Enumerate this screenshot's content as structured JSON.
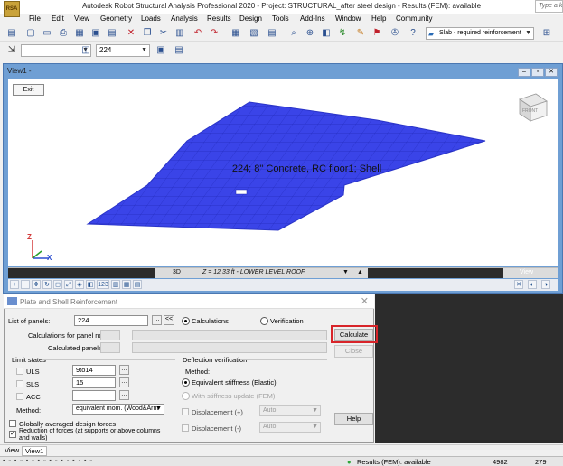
{
  "window": {
    "title": "Autodesk Robot Structural Analysis Professional 2020 - Project: STRUCTURAL_after steel design - Results (FEM): available",
    "app_icon_text": "RSA",
    "search_placeholder": "Type a keyword"
  },
  "menu": [
    "File",
    "Edit",
    "View",
    "Geometry",
    "Loads",
    "Analysis",
    "Results",
    "Design",
    "Tools",
    "Add-Ins",
    "Window",
    "Help",
    "Community"
  ],
  "toolbar": {
    "slab_select": "Slab - required reinforcement",
    "combo_case": "",
    "combo_panel": "224"
  },
  "view": {
    "title": "View1 -",
    "exit_label": "Exit",
    "cube_label": "FRONT",
    "slab_label": "224; 8\" Concrete, RC floor1; Shell",
    "mode": "3D",
    "level": "Z = 12.33 ft - LOWER LEVEL ROOF",
    "view_label": "View",
    "axis_x": "X",
    "axis_z": "Z",
    "zoom_text": "123"
  },
  "dialog": {
    "title": "Plate and Shell Reinforcement",
    "list_of_panels_label": "List of panels:",
    "list_of_panels_value": "224",
    "browse_btn": "...",
    "prev_btn": "<<",
    "radio_calculations": "Calculations",
    "radio_verification": "Verification",
    "calc_for_panel_label": "Calculations for panel no.:",
    "calculated_panels_label": "Calculated panels:",
    "calculate_btn": "Calculate",
    "close_btn": "Close",
    "help_btn": "Help",
    "limit_states_label": "Limit states",
    "uls_label": "ULS",
    "uls_value": "9to14",
    "sls_label": "SLS",
    "sls_value": "15",
    "acc_label": "ACC",
    "acc_value": "",
    "method_label": "Method:",
    "method_value": "equivalent mom. (Wood&Arm",
    "global_avg_label": "Globally averaged design forces",
    "reduction_label": "Reduction of forces (at supports or above columns and walls)",
    "deflection_label": "Deflection verification",
    "deflection_method_label": "Method:",
    "equiv_stiffness_label": "Equivalent stiffness (Elastic)",
    "with_stiffness_label": "With stiffness update (FEM)",
    "displacement_plus_label": "Displacement (+)",
    "displacement_minus_label": "Displacement (-)",
    "auto_label": "Auto"
  },
  "tabs": [
    "View",
    "View1"
  ],
  "status": {
    "results": "Results (FEM): available",
    "num1": "4982",
    "num2": "279"
  },
  "colors": {
    "slab_fill": "#3a44e8",
    "slab_mesh": "#1c24b0",
    "mdi_background": "#6f9fd4",
    "highlight": "#d8242a",
    "status_ok": "#2fa63a"
  }
}
